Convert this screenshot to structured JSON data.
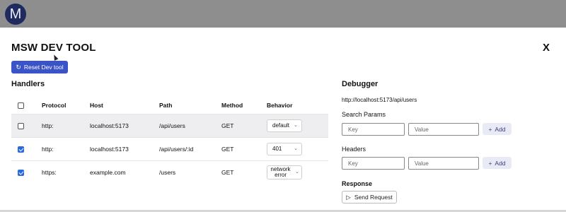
{
  "topbar": {
    "avatar_letter": "M"
  },
  "panel": {
    "title": "MSW DEV TOOL",
    "close_label": "X",
    "reset_label": "Reset Dev tool"
  },
  "handlers": {
    "heading": "Handlers",
    "columns": [
      "Protocol",
      "Host",
      "Path",
      "Method",
      "Behavior"
    ],
    "rows": [
      {
        "checked": false,
        "protocol": "http:",
        "host": "localhost:5173",
        "path": "/api/users",
        "method": "GET",
        "behavior": "default"
      },
      {
        "checked": true,
        "protocol": "http:",
        "host": "localhost:5173",
        "path": "/api/users/:id",
        "method": "GET",
        "behavior": "401"
      },
      {
        "checked": true,
        "protocol": "https:",
        "host": "example.com",
        "path": "/users",
        "method": "GET",
        "behavior": "network error"
      }
    ]
  },
  "debugger": {
    "heading": "Debugger",
    "url": "http://localhost:5173/api/users",
    "search_params_label": "Search Params",
    "headers_label": "Headers",
    "key_placeholder": "Key",
    "value_placeholder": "Value",
    "add_label": "Add",
    "response_label": "Response",
    "send_label": "Send Request"
  }
}
